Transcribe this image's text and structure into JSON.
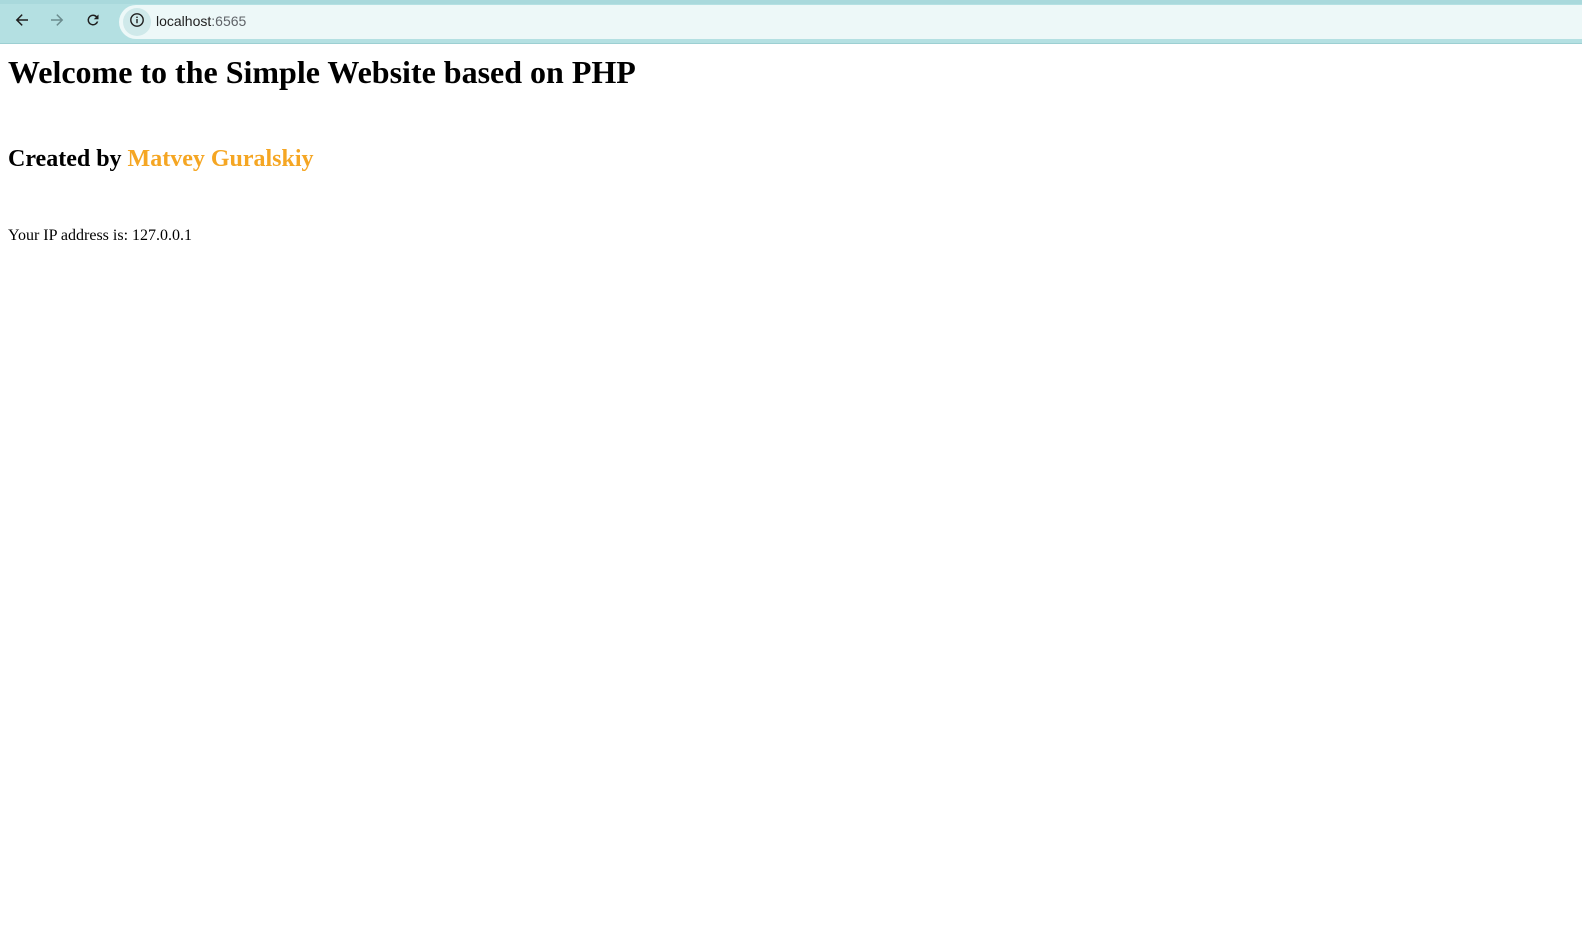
{
  "browser": {
    "url_host": "localhost",
    "url_port": ":6565",
    "icons": {
      "back": "arrow-left-icon",
      "forward": "arrow-right-icon",
      "reload": "reload-icon",
      "site_info": "info-icon"
    }
  },
  "page": {
    "heading": "Welcome to the Simple Website based on PHP",
    "created_by_prefix": "Created by ",
    "author": "Matvey Guralskiy",
    "ip_label": "Your IP address is: ",
    "ip_value": "127.0.0.1"
  },
  "colors": {
    "author": "#f5a623",
    "toolbar": "#b4e0e2",
    "omnibox": "#edf8f8"
  }
}
